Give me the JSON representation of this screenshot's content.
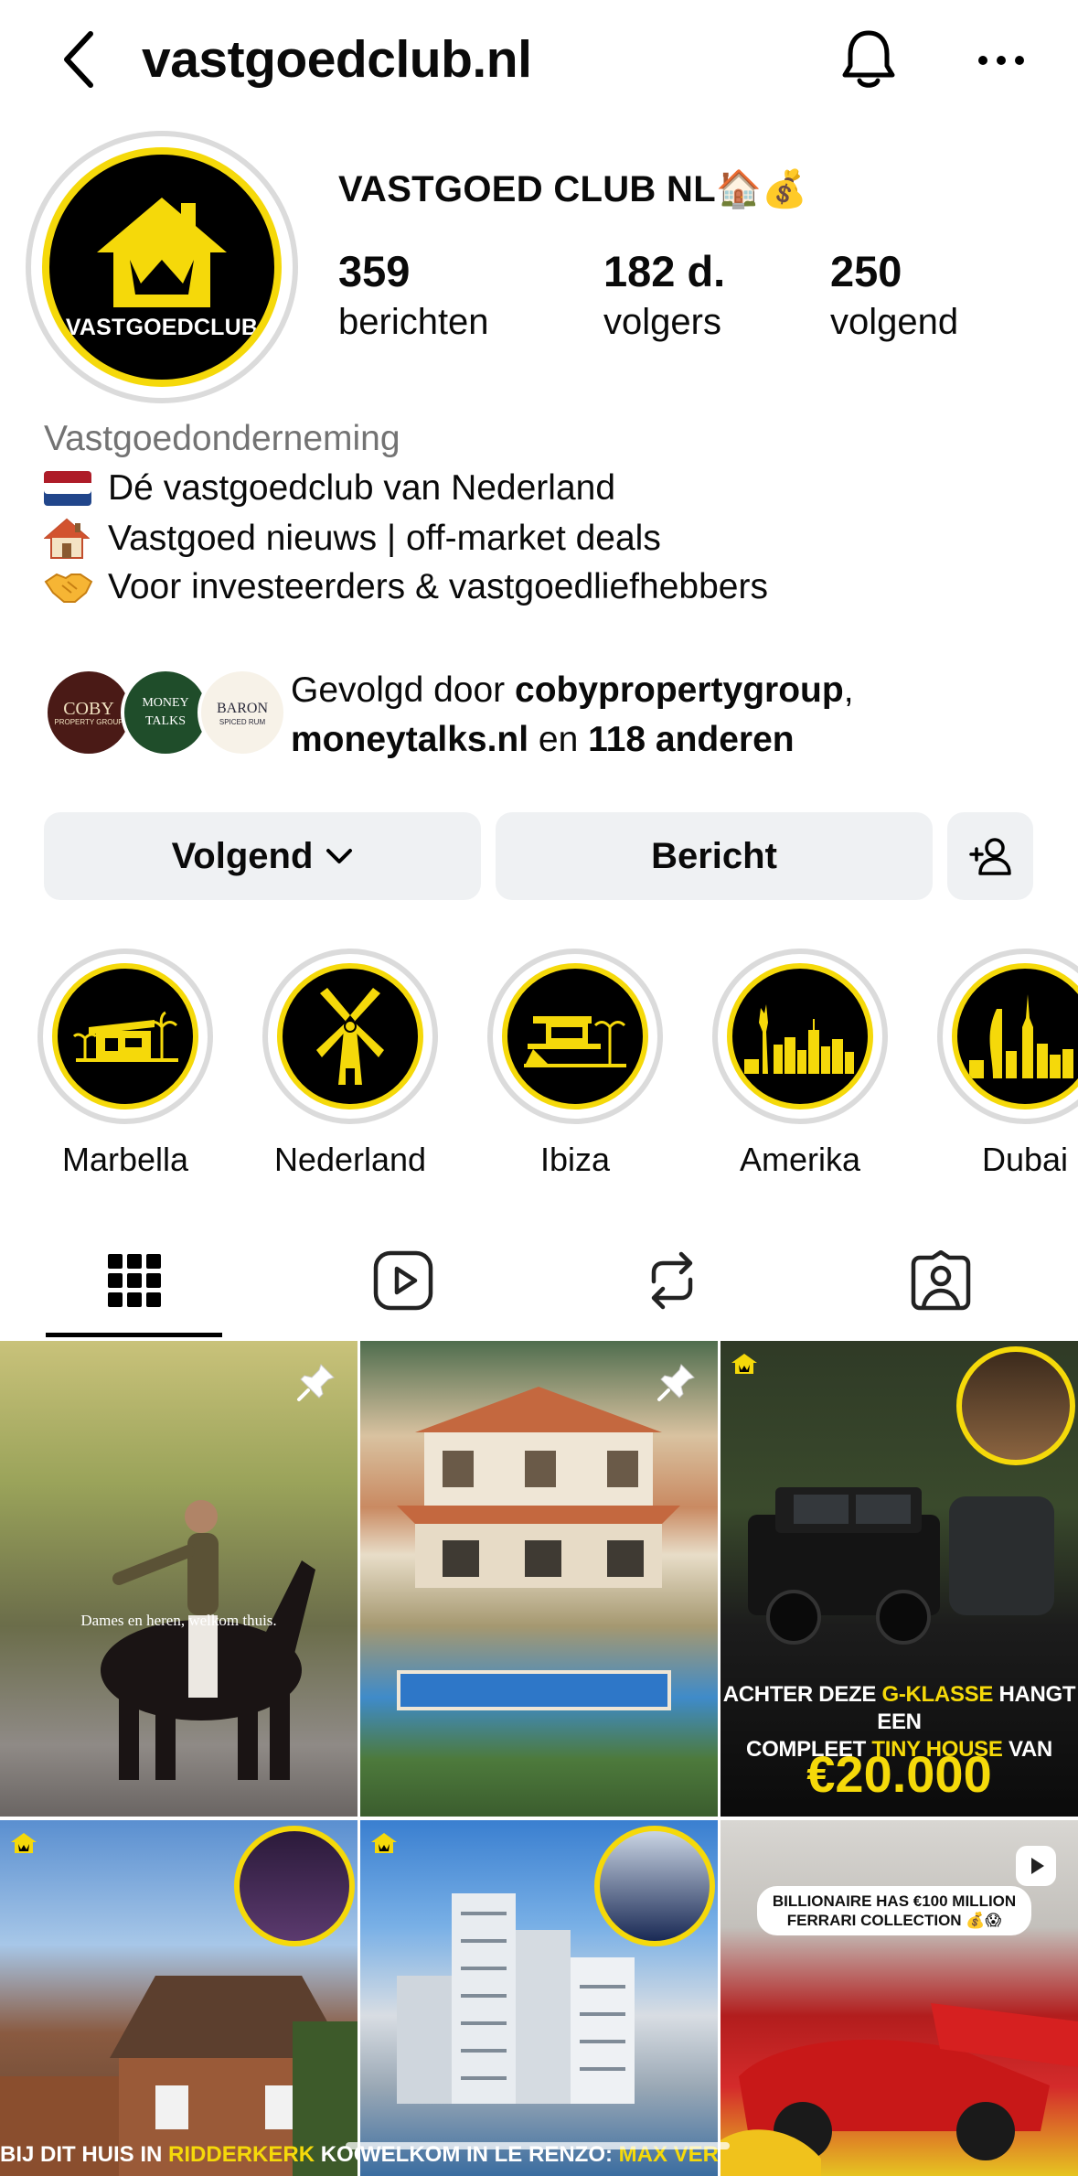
{
  "header": {
    "username": "vastgoedclub.nl"
  },
  "profile": {
    "display_name": "VASTGOED CLUB NL🏠💰",
    "avatar_text": "VASTGOEDCLUB",
    "stats": [
      {
        "value": "359",
        "label": "berichten"
      },
      {
        "value": "182 d.",
        "label": "volgers"
      },
      {
        "value": "250",
        "label": "volgend"
      }
    ]
  },
  "bio": {
    "category": "Vastgoedonderneming",
    "lines": [
      {
        "emoji": "🇳🇱",
        "text": "Dé vastgoedclub van Nederland"
      },
      {
        "emoji": "🏠",
        "text": "Vastgoed nieuws | off-market deals"
      },
      {
        "emoji": "🤝",
        "text": "Voor investeerders & vastgoedliefhebbers"
      }
    ]
  },
  "followed_by": {
    "prefix": "Gevolgd door ",
    "account1": "cobypropertygroup",
    "sep": ",",
    "account2": "moneytalks.nl",
    "mid": " en ",
    "others": "118 anderen",
    "avatars": [
      {
        "main": "COBY",
        "sub": "PROPERTY GROUP"
      },
      {
        "main": "MONEY TALKS",
        "sub": ""
      },
      {
        "main": "BARON",
        "sub": "SPICED RUM"
      }
    ]
  },
  "actions": {
    "follow_label": "Volgend",
    "message_label": "Bericht"
  },
  "highlights": [
    {
      "label": "Marbella"
    },
    {
      "label": "Nederland"
    },
    {
      "label": "Ibiza"
    },
    {
      "label": "Amerika"
    },
    {
      "label": "Dubai"
    }
  ],
  "posts": [
    {
      "caption": "Dames en heren, welkom thuis."
    },
    {
      "caption": ""
    },
    {
      "caption_line1_a": "ACHTER DEZE ",
      "caption_line1_b": "G-KLASSE",
      "caption_line1_c": " HANGT EEN",
      "caption_line2_a": "COMPLEET ",
      "caption_line2_b": "TINY HOUSE",
      "caption_line2_c": " VAN",
      "price": "€20.000"
    },
    {
      "caption_a": "BIJ DIT HUIS IN ",
      "caption_b": "RIDDERKERK",
      "caption_c": " KOOP JE"
    },
    {
      "caption_a": "WELKOM IN LE RENZO: ",
      "caption_b": "MAX VERSTAPPENS"
    },
    {
      "caption_line1": "BILLIONAIRE HAS €100 MILLION",
      "caption_line2": "FERRARI COLLECTION 💰😱"
    }
  ],
  "icons": {
    "back": "chevron-left-icon",
    "bell": "bell-icon",
    "more": "more-horizontal-icon",
    "grid": "grid-icon",
    "reels": "reels-icon",
    "reposts": "repost-icon",
    "tagged": "tagged-icon"
  },
  "colors": {
    "brand_yellow": "#f5d90a",
    "button_bg": "#eff1f3",
    "muted_text": "#737373"
  }
}
